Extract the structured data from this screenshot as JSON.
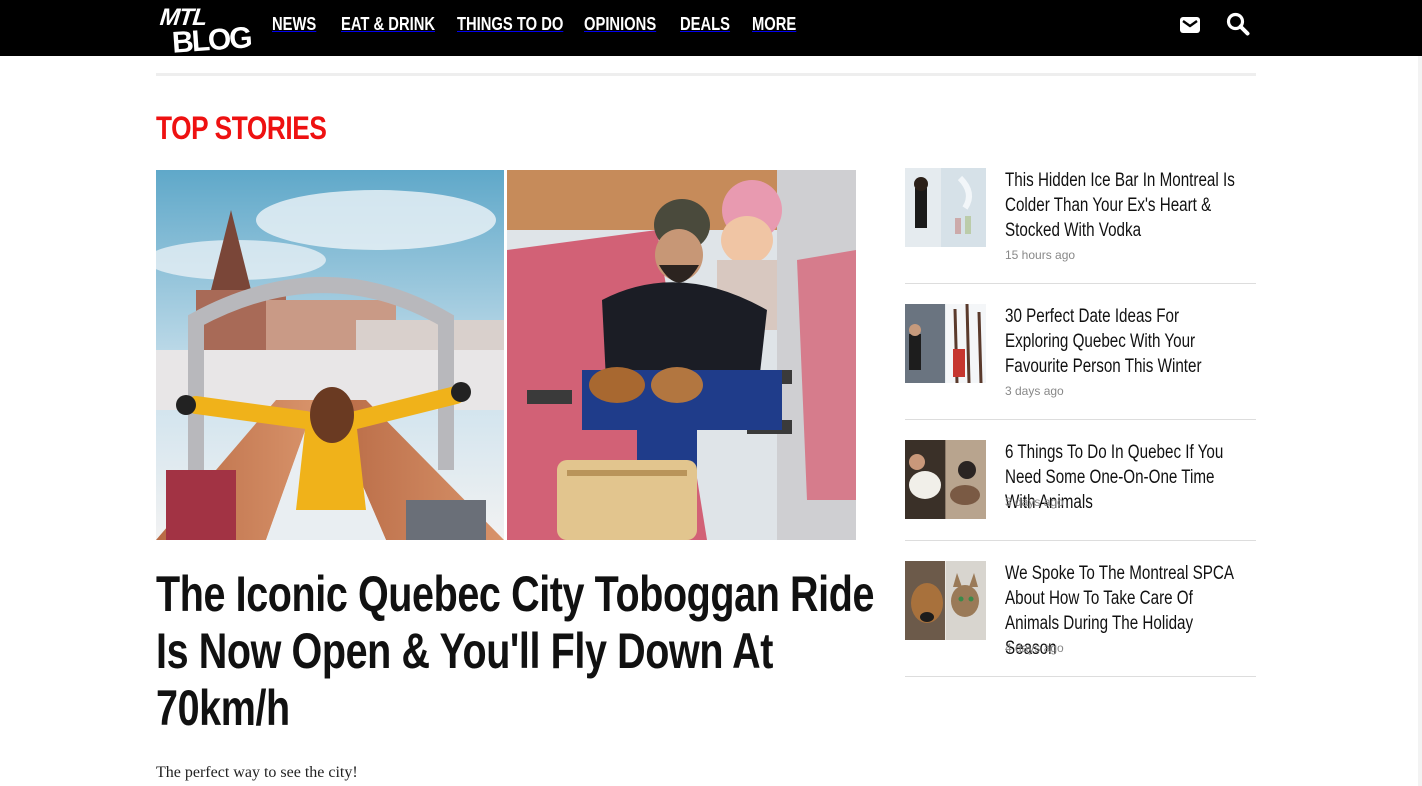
{
  "brand": {
    "logo_top": "MTL",
    "logo_bottom": "BLOG"
  },
  "nav": {
    "items": [
      "NEWS",
      "EAT & DRINK",
      "THINGS TO DO",
      "OPINIONS",
      "DEALS",
      "MORE"
    ]
  },
  "icons": {
    "mail": "envelope-icon",
    "search": "search-icon"
  },
  "colors": {
    "accent": "#ee1111",
    "topbar": "#000000"
  },
  "section": {
    "title": "TOP STORIES"
  },
  "featured": {
    "headline": "The Iconic Quebec City Toboggan Ride Is Now Open & You'll Fly Down At 70km/h",
    "subline": "The perfect way to see the city!"
  },
  "sidebar": {
    "items": [
      {
        "title": "This Hidden Ice Bar In Montreal Is Colder Than Your Ex's Heart & Stocked With Vodka",
        "time": "15 hours ago"
      },
      {
        "title": "30 Perfect Date Ideas For Exploring Quebec With Your Favourite Person This Winter",
        "time": "3 days ago"
      },
      {
        "title": "6 Things To Do In Quebec If You Need Some One-On-One Time With Animals",
        "time": "3 days ago"
      },
      {
        "title": "We Spoke To The Montreal SPCA About How To Take Care Of Animals During The Holiday Season",
        "time": "4 days ago"
      }
    ]
  }
}
